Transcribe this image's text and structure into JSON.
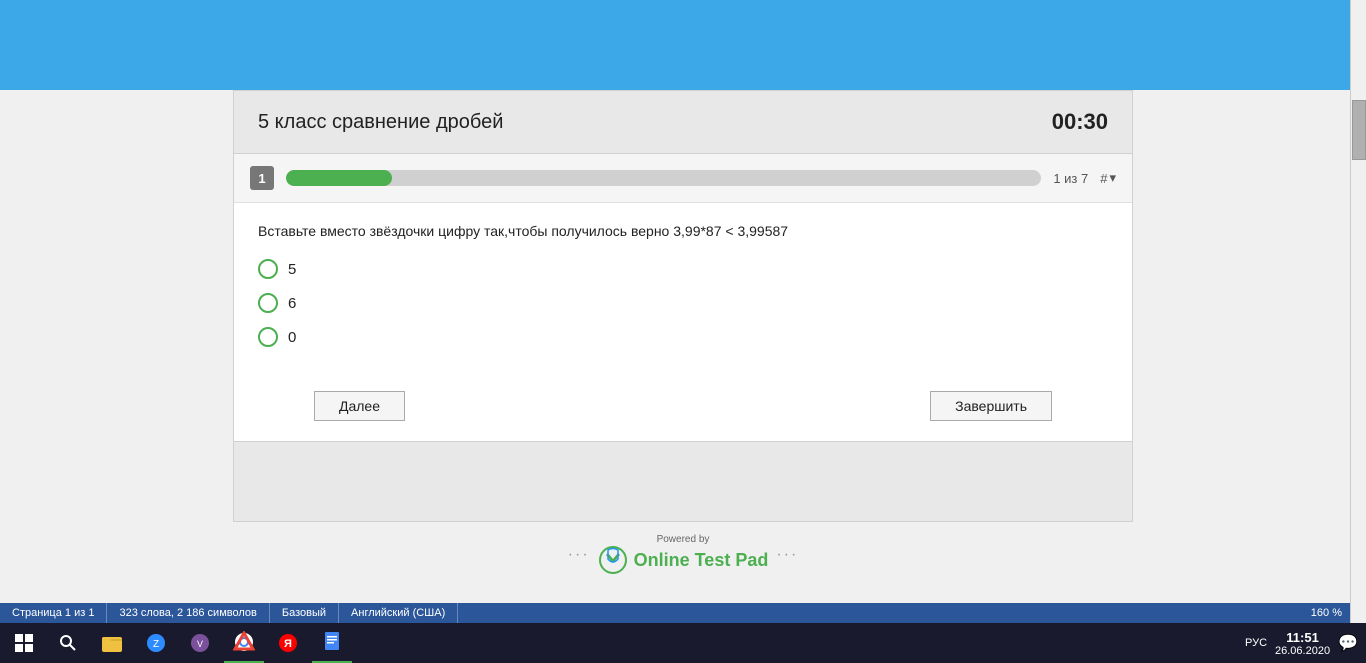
{
  "header": {
    "bg_color": "#3da8e8"
  },
  "card": {
    "title": "5 класс сравнение дробей",
    "timer": "00:30",
    "progress": {
      "question_number": "1",
      "bar_percent": 14,
      "progress_text": "1 из 7",
      "hash_label": "#"
    },
    "question": {
      "text": "Вставьте вместо звёздочки цифру так,чтобы получилось верно   3,99*87 < 3,99587"
    },
    "options": [
      {
        "value": "5",
        "label": "5"
      },
      {
        "value": "6",
        "label": "6"
      },
      {
        "value": "0",
        "label": "0"
      }
    ],
    "btn_next": "Далее",
    "btn_finish": "Завершить"
  },
  "powered": {
    "powered_by": "Powered by",
    "logo_text": "Online Test Pad",
    "dots_left": "···",
    "dots_right": "···"
  },
  "status_bar": {
    "page_info": "Страница 1 из 1",
    "word_count": "323 слова, 2 186 символов",
    "mode": "Базовый",
    "language": "Английский (США)",
    "zoom": "160 %"
  },
  "taskbar": {
    "time": "11:51",
    "date": "26.06.2020",
    "language": "РУС"
  }
}
